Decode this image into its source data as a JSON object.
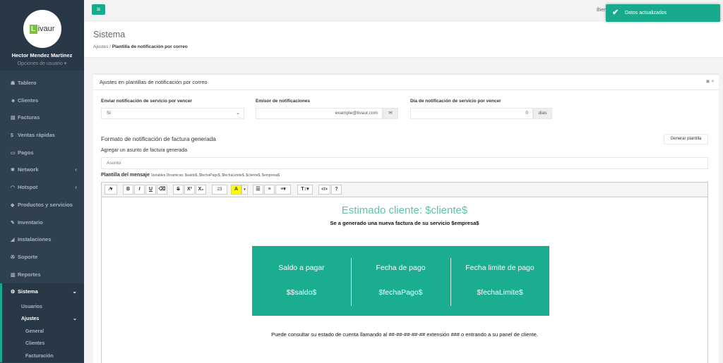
{
  "user": {
    "logo_mark": "L",
    "logo_text": "ivaur",
    "name": "Hector Mendez Martinez",
    "options": "Opciones de usuario ▾"
  },
  "nav": [
    {
      "icon": "☗",
      "label": "Tablero"
    },
    {
      "icon": "☻",
      "label": "Clientes"
    },
    {
      "icon": "▤",
      "label": "Facturas"
    },
    {
      "icon": "$",
      "label": "Ventas rápidas"
    },
    {
      "icon": "▭",
      "label": "Pagos"
    },
    {
      "icon": "✱",
      "label": "Network",
      "arrow": "‹"
    },
    {
      "icon": "◠",
      "label": "Hotspot",
      "arrow": "‹"
    },
    {
      "icon": "◆",
      "label": "Productos y servicios"
    },
    {
      "icon": "✎",
      "label": "Inventario"
    },
    {
      "icon": "◢",
      "label": "Instalaciones"
    },
    {
      "icon": "✇",
      "label": "Soporte"
    },
    {
      "icon": "▥",
      "label": "Reportes"
    }
  ],
  "nav_active": {
    "icon": "⚙",
    "label": "Sistema",
    "arrow": "⌄"
  },
  "subnav": {
    "usuarios": "Usuarios",
    "ajustes": "Ajustes",
    "ajustes_arrow": "⌄",
    "general": "General",
    "clientes": "Clientes",
    "facturacion": "Facturación"
  },
  "topbar": {
    "menu_icon": "≡",
    "welcome": "Bien"
  },
  "toast": {
    "check": "✔",
    "text": "Datos actualizados"
  },
  "page": {
    "title": "Sistema",
    "crumb_root": "Ajustes",
    "crumb_sep": "/",
    "crumb_current": "Plantilla de notificación por correo"
  },
  "panel": {
    "title": "Ajustes en plantillas de notificación por correo",
    "tools": "▣ ✕",
    "enviar_label": "Enviar notificación de servicio por vencer",
    "enviar_value": "Si",
    "emisor_label": "Emisor de notificaciones",
    "emisor_value": "example@livaur.com",
    "emisor_icon": "✉",
    "dia_label": "Día de notificación de servicio por vencer",
    "dia_value": "0",
    "dia_unit": "dias",
    "formato_title": "Formato de notificación de factura generada",
    "generar_button": "Generar plantilla",
    "asunto_label": "Agregar un asunto de factura generada",
    "asunto_placeholder": "Asunto",
    "plantilla_label": "Plantilla del mensaje",
    "variables_hint": "Variables Dinamicas: $saldo$, $fechaPago$, $fechaLimite$, $cliente$, $empresa$"
  },
  "toolbar": {
    "magic": "⁄▾",
    "bold": "B",
    "italic": "I",
    "underline": "U",
    "eraser": "⌫",
    "strike": "S",
    "sup": "X²",
    "sub": "X₂",
    "fontsize": "23",
    "color": "A",
    "color_caret": "▾",
    "ul": "☰",
    "ol": "≡",
    "align": "≡▾",
    "textsize": "T↕▾",
    "code": "</>",
    "help": "?"
  },
  "email": {
    "heading": "Estimado cliente: $cliente$",
    "subheading": "Se a generado una nueva factura de su servicio $empresa$",
    "columns": [
      {
        "title": "Saldo a pagar",
        "value": "$$saldo$"
      },
      {
        "title": "Fecha de pago",
        "value": "$fechaPago$"
      },
      {
        "title": "Fecha limite de pago",
        "value": "$fechaLimite$"
      }
    ],
    "footer": "Puede consultar su estado de cuenta llamando al ##-##-##-##-## extensión ### o entrando a su panel de cliente."
  },
  "colors": {
    "accent": "#19aa8d",
    "sidebar": "#2f4050",
    "email_heading": "#5ec3aa"
  }
}
